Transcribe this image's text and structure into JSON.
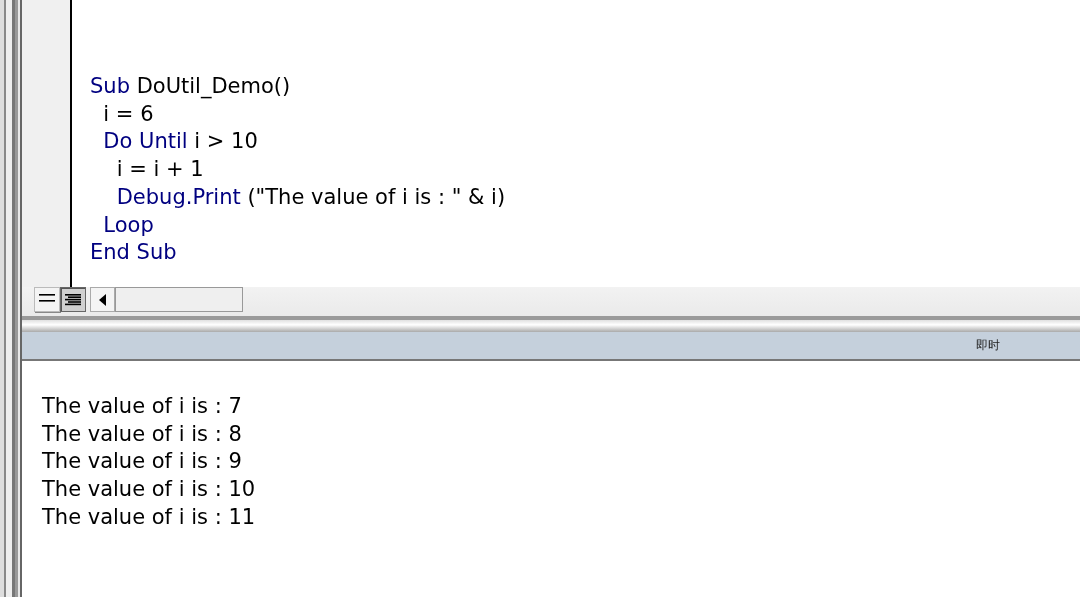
{
  "code_window": {
    "lines": [
      [
        {
          "kind": "keyword",
          "text": "Sub"
        },
        {
          "kind": "plain",
          "text": " DoUtil_Demo()"
        }
      ],
      [
        {
          "kind": "plain",
          "text": "  i = 6"
        }
      ],
      [
        {
          "kind": "keyword",
          "text": "  Do Until"
        },
        {
          "kind": "plain",
          "text": " i > 10"
        }
      ],
      [
        {
          "kind": "plain",
          "text": "    i = i + 1"
        }
      ],
      [
        {
          "kind": "keyword",
          "text": "    Debug.Print"
        },
        {
          "kind": "plain",
          "text": " (\"The value of i is : \" & i)"
        }
      ],
      [
        {
          "kind": "keyword",
          "text": "  Loop"
        }
      ],
      [
        {
          "kind": "keyword",
          "text": "End Sub"
        }
      ]
    ],
    "view_buttons": [
      {
        "kind": "procedure",
        "selected": false
      },
      {
        "kind": "module",
        "selected": true
      }
    ]
  },
  "immediate_window": {
    "title": "即时",
    "lines": [
      "The value of i is : 7",
      "The value of i is : 8",
      "The value of i is : 9",
      "The value of i is : 10",
      "The value of i is : 11"
    ]
  }
}
